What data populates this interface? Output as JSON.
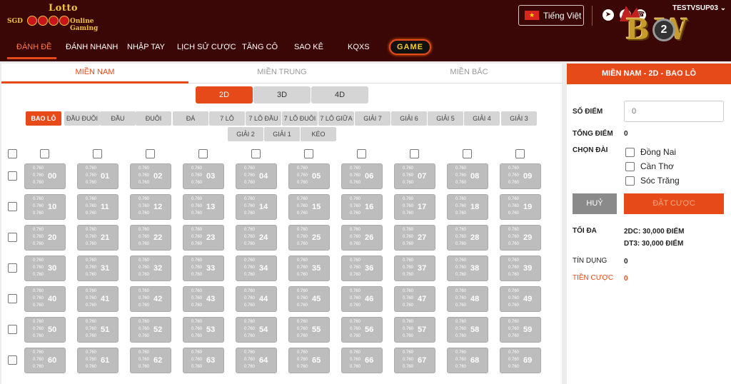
{
  "brand": {
    "lotto": "Lotto",
    "sgd": "SGD",
    "online_gaming": "Online Gaming",
    "b2w_text": "B W",
    "b2w_coin": "2"
  },
  "header": {
    "language": "Tiếng Việt",
    "username": "TESTVSUP03",
    "icons": [
      "telegram-icon",
      "viber-icon",
      "phone-icon"
    ]
  },
  "nav": {
    "items": [
      "ĐÁNH ĐỀ",
      "ĐÁNH NHANH",
      "NHẬP TAY",
      "LỊCH SỬ CƯỢC",
      "TĂNG CÔ",
      "SAO KÊ",
      "KQXS"
    ],
    "game": "GAME"
  },
  "region_tabs": [
    "MIỀN NAM",
    "MIỀN TRUNG",
    "MIỀN BẮC"
  ],
  "digit_tabs": [
    "2D",
    "3D",
    "4D"
  ],
  "bet_types_row1": [
    "BAO LÔ",
    "ĐẦU ĐUÔI",
    "ĐẦU",
    "ĐUÔI",
    "ĐÁ",
    "7 LÔ",
    "7 LÔ ĐẦU",
    "7 LÔ ĐUÔI",
    "7 LÔ GIỮA",
    "GIẢI 7",
    "GIẢI 6",
    "GIẢI 5",
    "GIẢI 4",
    "GIẢI 3"
  ],
  "bet_types_row2": [
    "GIẢI 2",
    "GIẢI 1",
    "KÉO"
  ],
  "odds": "0.760",
  "numbers": [
    [
      "00",
      "01",
      "02",
      "03",
      "04",
      "05",
      "06",
      "07",
      "08",
      "09"
    ],
    [
      "10",
      "11",
      "12",
      "13",
      "14",
      "15",
      "16",
      "17",
      "18",
      "19"
    ],
    [
      "20",
      "21",
      "22",
      "23",
      "24",
      "25",
      "26",
      "27",
      "28",
      "29"
    ],
    [
      "30",
      "31",
      "32",
      "33",
      "34",
      "35",
      "36",
      "37",
      "38",
      "39"
    ],
    [
      "40",
      "41",
      "42",
      "43",
      "44",
      "45",
      "46",
      "47",
      "48",
      "49"
    ],
    [
      "50",
      "51",
      "52",
      "53",
      "54",
      "55",
      "56",
      "57",
      "58",
      "59"
    ],
    [
      "60",
      "61",
      "62",
      "63",
      "64",
      "65",
      "66",
      "67",
      "68",
      "69"
    ]
  ],
  "panel": {
    "title": "MIỀN NAM - 2D - BAO LÔ",
    "so_diem_label": "SỐ ĐIỂM",
    "so_diem_placeholder": "0",
    "tong_diem_label": "TỔNG ĐIỂM",
    "tong_diem_value": "0",
    "chon_dai_label": "CHỌN ĐÀI",
    "stations": [
      "Đồng Nai",
      "Cần Thơ",
      "Sóc Trăng"
    ],
    "cancel": "HUỶ",
    "bet": "ĐẶT CƯỢC",
    "toi_da_label": "TỐI ĐA",
    "toi_da_2dc": "2DC: 30,000 ĐIỂM",
    "toi_da_dt3": "DT3: 30,000 ĐIỂM",
    "tin_dung_label": "TÍN DỤNG",
    "tin_dung_value": "0",
    "tien_cuoc_label": "TIỀN CƯỢC",
    "tien_cuoc_value": "0"
  },
  "colors": {
    "header_bg": "#3a0606",
    "accent": "#e64a19",
    "cell_bg": "#bdbdbd"
  }
}
